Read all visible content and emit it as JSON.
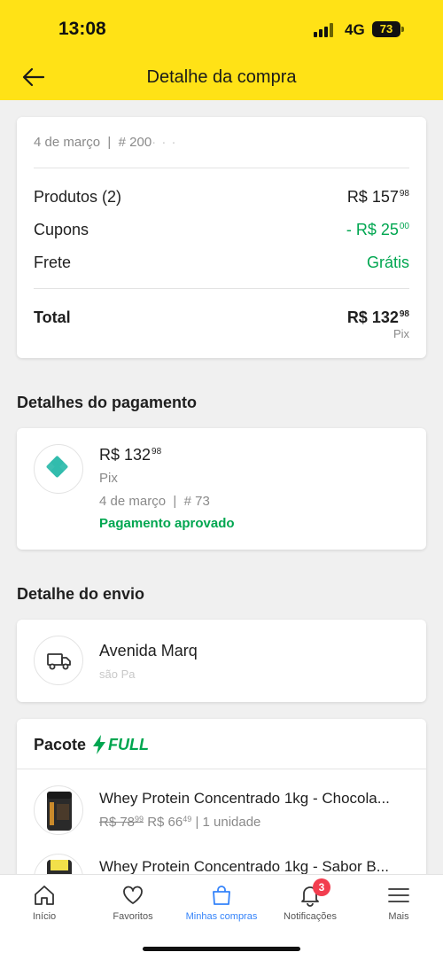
{
  "status_bar": {
    "time": "13:08",
    "network": "4G",
    "battery": "73"
  },
  "header": {
    "title": "Detalhe da compra"
  },
  "summary": {
    "date": "4 de março",
    "order_prefix": "# 200",
    "order_blurred": "· · ·",
    "rows": [
      {
        "label": "Produtos (2)",
        "currency": "R$ ",
        "int": "157",
        "cents": "98"
      },
      {
        "label": "Cupons",
        "currency": "- R$ ",
        "int": "25",
        "cents": "00"
      },
      {
        "label": "Frete",
        "value": "Grátis"
      }
    ],
    "total": {
      "label": "Total",
      "currency": "R$ ",
      "int": "132",
      "cents": "98",
      "method": "Pix"
    }
  },
  "payment": {
    "section_title": "Detalhes do pagamento",
    "amount_int": "R$ 132",
    "amount_cents": "98",
    "method": "Pix",
    "date": "4 de março",
    "ref": "# 73",
    "status": "Pagamento aprovado",
    "icon": "pix-icon"
  },
  "shipping": {
    "section_title": "Detalhe do envio",
    "address_line1": "Avenida Marq",
    "address_line2": "são Pa",
    "icon": "truck-icon"
  },
  "package": {
    "label": "Pacote",
    "badge": "FULL",
    "items": [
      {
        "title": "Whey Protein Concentrado 1kg - Chocola...",
        "old_int": "R$ 78",
        "old_cents": "99",
        "new_int": "R$ 66",
        "new_cents": "49",
        "qty": "| 1 unidade"
      },
      {
        "title": "Whey Protein Concentrado 1kg - Sabor B..."
      }
    ]
  },
  "tabbar": {
    "tabs": [
      {
        "label": "Início",
        "icon": "home-icon"
      },
      {
        "label": "Favoritos",
        "icon": "heart-icon"
      },
      {
        "label": "Minhas compras",
        "icon": "shopping-bag-icon",
        "active": true
      },
      {
        "label": "Notificações",
        "icon": "bell-icon",
        "badge": "3"
      },
      {
        "label": "Mais",
        "icon": "menu-icon"
      }
    ]
  },
  "colors": {
    "header": "#ffe216",
    "green": "#00a650",
    "active_tab": "#3483fa",
    "badge": "#f23d4f"
  }
}
